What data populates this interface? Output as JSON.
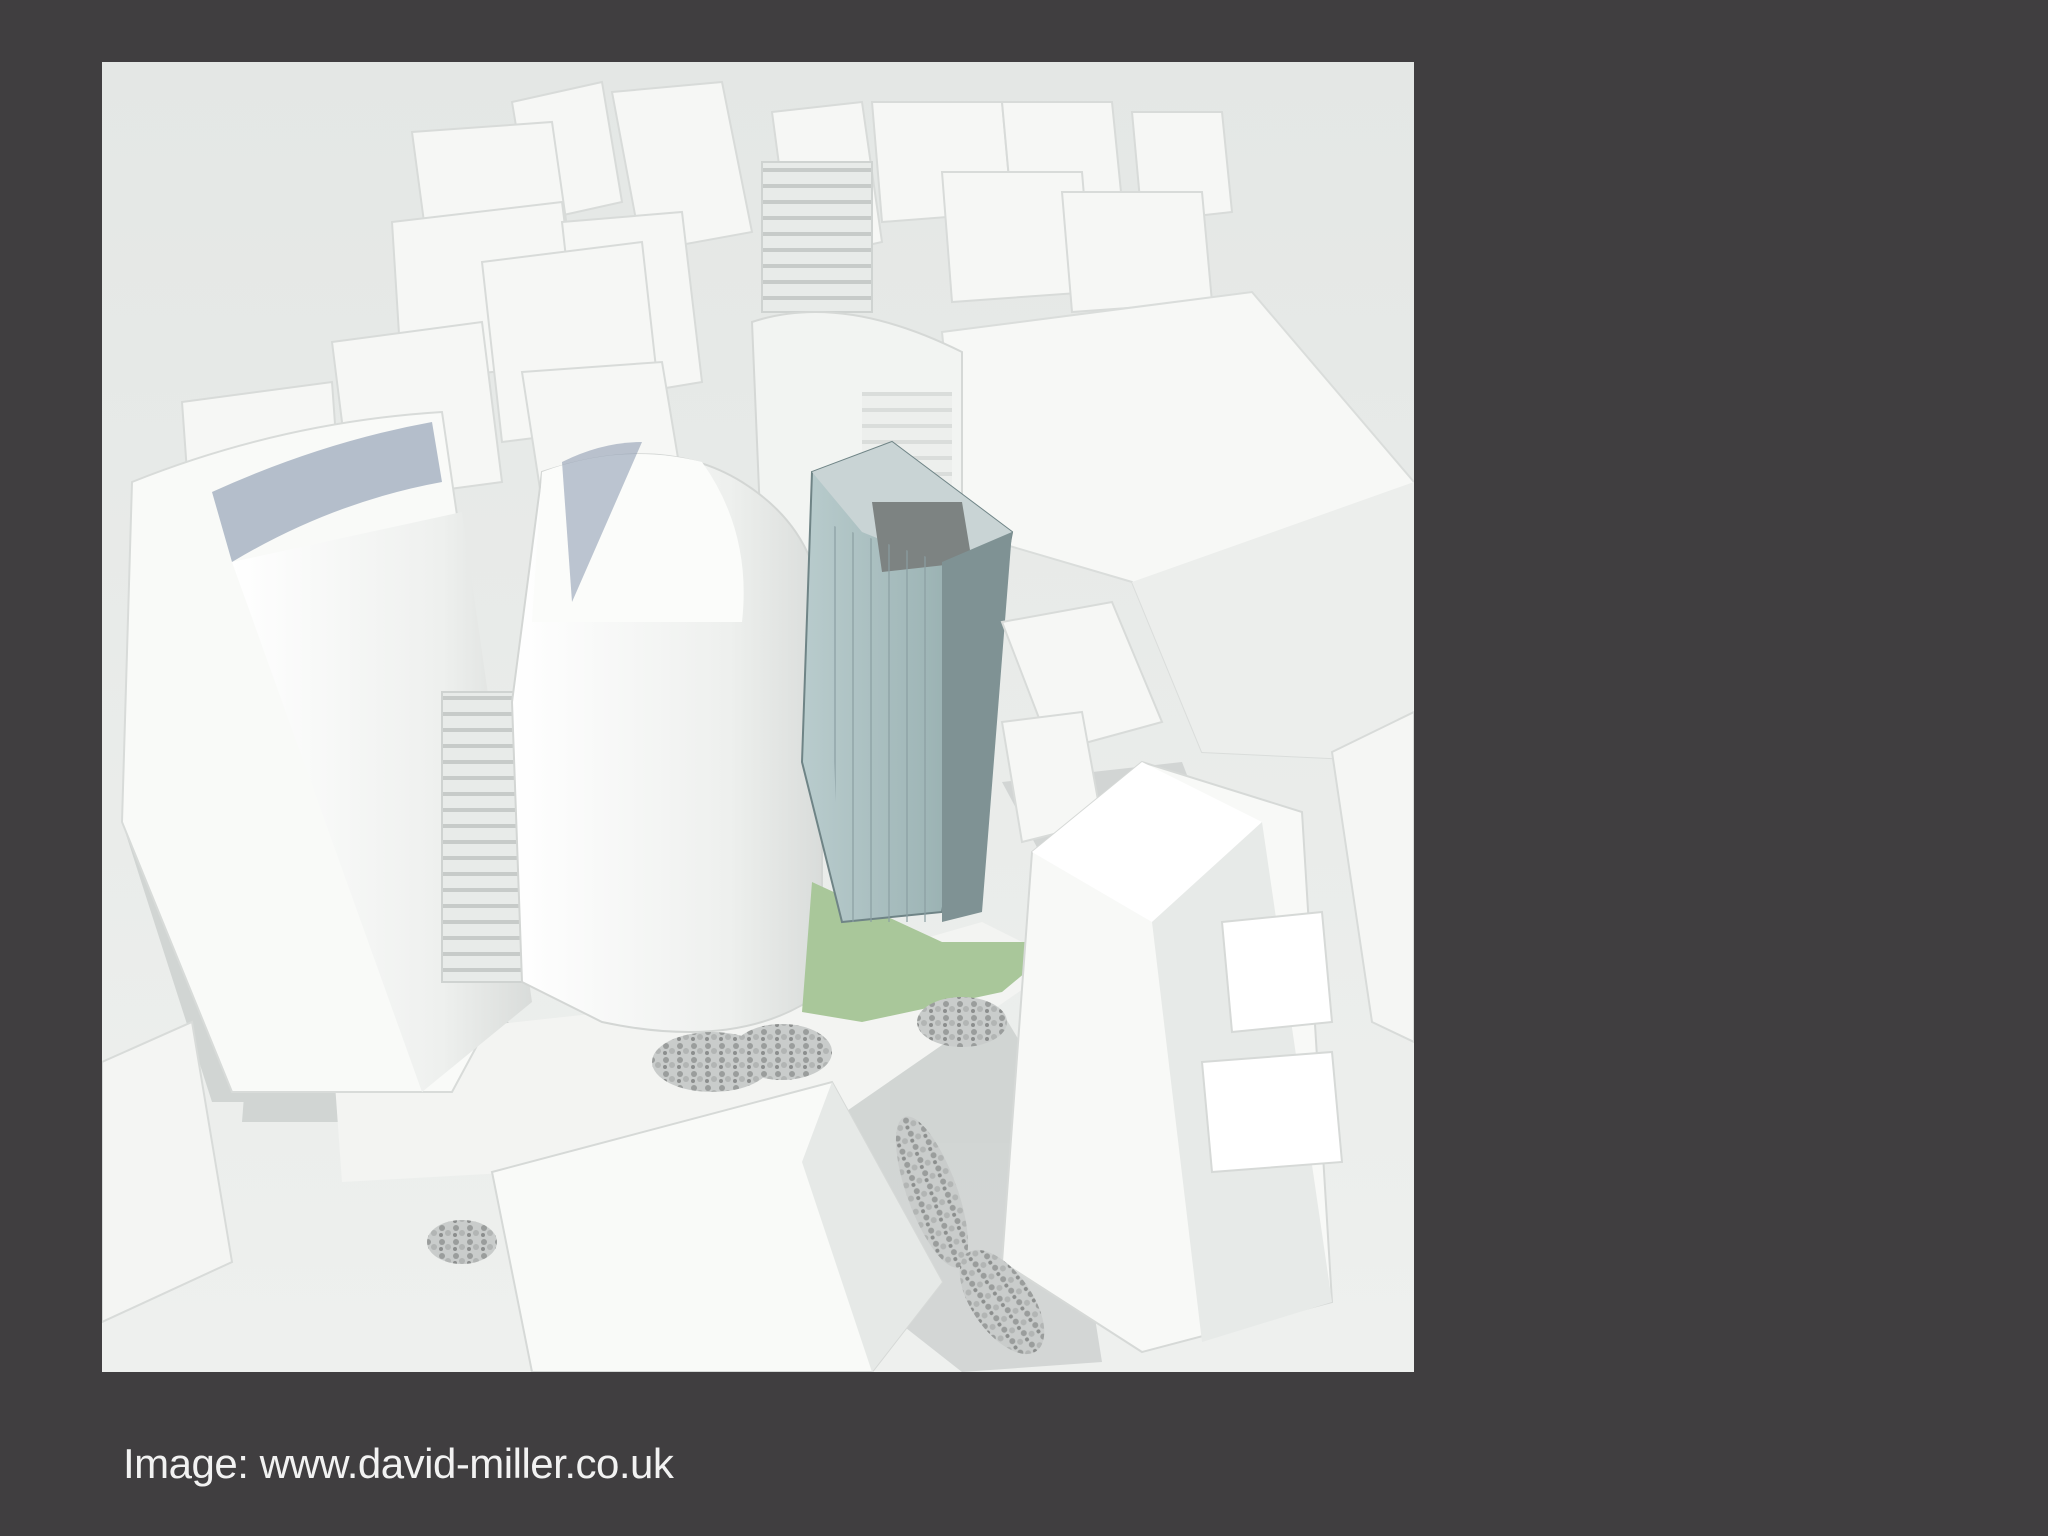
{
  "slide": {
    "background_color": "#403e40",
    "image": {
      "subject": "aerial-render-of-city-block-model",
      "accent_tower_color": "#9fb6b7",
      "landscape_color": "#a9c79a",
      "massing_color": "#f4f5f3"
    },
    "caption": "Image: www.david-miller.co.uk"
  }
}
